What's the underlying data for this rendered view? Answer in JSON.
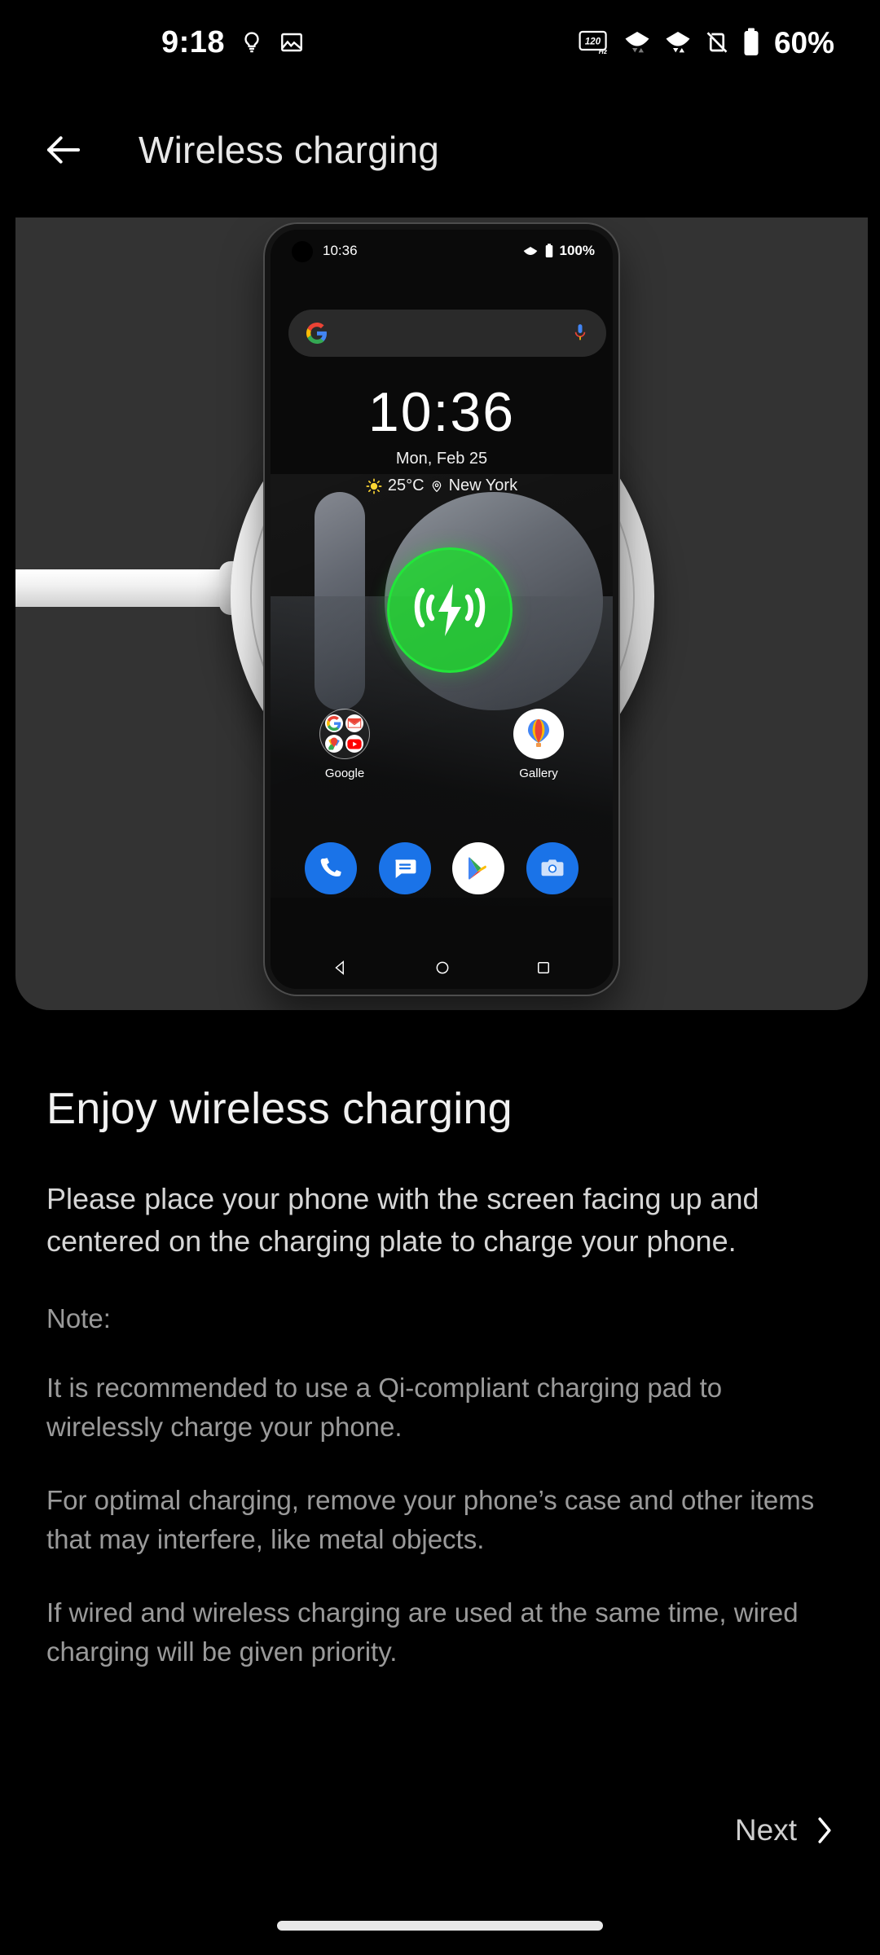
{
  "status_bar": {
    "time": "9:18",
    "icons_left": [
      "lightbulb-icon",
      "image-icon"
    ],
    "refresh_rate": "120",
    "refresh_rate_unit": "Hz",
    "icons_right": [
      "signal-icon",
      "wifi-icon",
      "rotation-lock-icon",
      "battery-icon"
    ],
    "battery_percent": "60%"
  },
  "app_bar": {
    "back_icon": "arrow-left-icon",
    "title": "Wireless charging"
  },
  "illustration": {
    "alt": "Phone resting on a white wireless charging pad with cable",
    "phone": {
      "status": {
        "time": "10:36",
        "battery_percent": "100%"
      },
      "search": {
        "logo": "google-g-icon",
        "mic": "microphone-icon"
      },
      "clock_widget": {
        "time": "10:36",
        "date": "Mon, Feb 25",
        "temperature": "25°C",
        "location": "New York"
      },
      "charging_badge": {
        "icon": "wireless-charging-bolt-icon",
        "color": "#1edd2e"
      },
      "apps": [
        {
          "label": "Google",
          "type": "folder",
          "icons": [
            "google-g-icon",
            "gmail-icon",
            "maps-icon",
            "youtube-icon"
          ]
        },
        {
          "label": "Gallery",
          "type": "app",
          "icon": "gallery-balloon-icon"
        }
      ],
      "dock": [
        {
          "name": "phone-icon",
          "color": "#1a73e8"
        },
        {
          "name": "messages-icon",
          "color": "#1a73e8"
        },
        {
          "name": "play-store-icon",
          "color": "#ffffff"
        },
        {
          "name": "camera-icon",
          "color": "#1a73e8"
        }
      ],
      "nav": [
        "back-triangle-icon",
        "home-circle-icon",
        "recents-square-icon"
      ]
    }
  },
  "main": {
    "headline": "Enjoy wireless charging",
    "description": "Please place your phone with the screen facing up and centered on the charging plate to charge your phone.",
    "note_label": "Note:",
    "notes": [
      "It is recommended to use a Qi-compliant charging pad to wirelessly charge your phone.",
      "For optimal charging, remove your phone’s case and other items that may interfere, like metal objects.",
      "If wired and wireless charging are used at the same time, wired charging will be given priority."
    ]
  },
  "footer": {
    "next_label": "Next",
    "next_icon": "chevron-right-icon"
  }
}
